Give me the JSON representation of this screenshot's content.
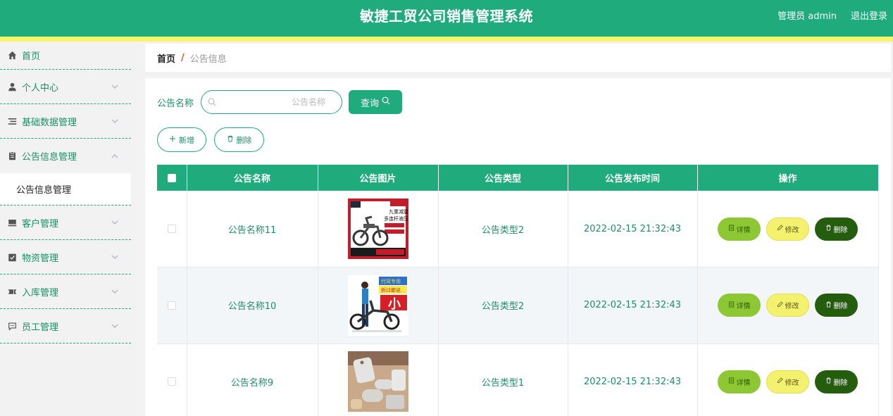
{
  "header": {
    "title": "敏捷工贸公司销售管理系统",
    "user_label": "管理员 admin",
    "logout_label": "退出登录"
  },
  "sidebar": {
    "items": [
      {
        "label": "首页",
        "icon": "home-icon"
      },
      {
        "label": "个人中心",
        "icon": "user-icon"
      },
      {
        "label": "基础数据管理",
        "icon": "list-icon"
      },
      {
        "label": "公告信息管理",
        "icon": "clipboard-icon",
        "expanded": true,
        "sub": [
          "公告信息管理"
        ]
      },
      {
        "label": "客户管理",
        "icon": "monitor-icon"
      },
      {
        "label": "物资管理",
        "icon": "checkbox-icon"
      },
      {
        "label": "入库管理",
        "icon": "ticket-icon"
      },
      {
        "label": "员工管理",
        "icon": "chat-icon"
      }
    ]
  },
  "breadcrumb": {
    "home": "首页",
    "separator": "/",
    "current": "公告信息"
  },
  "search": {
    "label": "公告名称",
    "placeholder": "公告名称",
    "button_label": "查询"
  },
  "actions": {
    "add_label": "新增",
    "delete_label": "删除"
  },
  "table": {
    "columns": [
      "公告名称",
      "公告图片",
      "公告类型",
      "公告发布时间",
      "操作"
    ],
    "rows": [
      {
        "name": "公告名称11",
        "image": "ebike-ad-image",
        "type": "公告类型2",
        "time": "2022-02-15 21:32:43"
      },
      {
        "name": "公告名称10",
        "image": "ebike-rider-image",
        "type": "公告类型2",
        "time": "2022-02-15 21:32:43"
      },
      {
        "name": "公告名称9",
        "image": "tags-image",
        "type": "公告类型1",
        "time": "2022-02-15 21:32:43"
      }
    ],
    "op_labels": {
      "detail": "详情",
      "edit": "修改",
      "delete": "删除"
    }
  },
  "thumb_text": {
    "ad1_line1": "九重减震",
    "ad1_line2": "多连杆液压",
    "ad2_line1": "代驾专用",
    "ad2_line2": "折过都说",
    "ad2_big": "小"
  },
  "colors": {
    "primary": "#1fab7c",
    "stripe": "#f6f56a",
    "detail": "#8dc733",
    "edit": "#f3f16e",
    "delete": "#255d0e"
  }
}
